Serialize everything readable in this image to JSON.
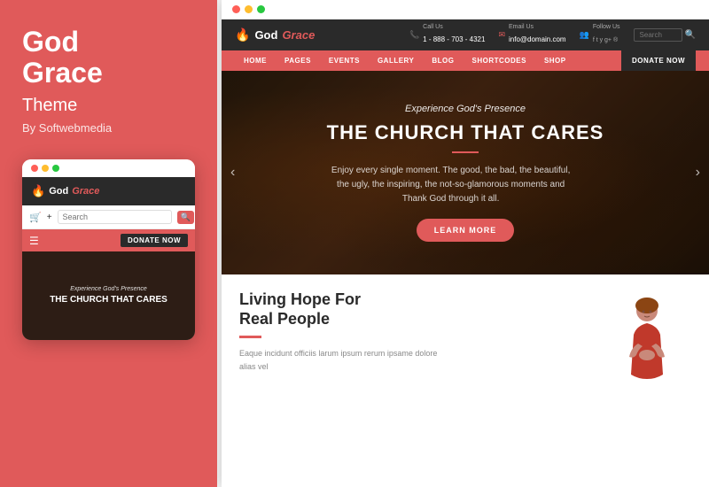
{
  "left": {
    "title_line1": "God",
    "title_line2": "Grace",
    "subtitle": "Theme",
    "by_text": "By Softwebmedia"
  },
  "mobile": {
    "dots": [
      "red",
      "yellow",
      "green"
    ],
    "logo_god": "God",
    "logo_grace": "Grace",
    "search_placeholder": "Search",
    "donate_btn": "DONATE NOW",
    "hero_sub": "Experience God's Presence",
    "hero_title": "THE CHURCH THAT CARES"
  },
  "desktop": {
    "dots": [
      "red",
      "yellow",
      "green"
    ],
    "logo_god": "God",
    "logo_grace": "Grace",
    "header": {
      "call_label": "Call Us",
      "call_value": "1 - 888 - 703 - 4321",
      "email_label": "Email Us",
      "email_value": "info@domain.com",
      "follow_label": "Follow Us",
      "search_placeholder": "Search"
    },
    "nav": {
      "items": [
        "HOME",
        "PAGES",
        "EVENTS",
        "GALLERY",
        "BLOG",
        "SHORTCODES",
        "SHOP"
      ],
      "donate_btn": "DONATE NOW"
    },
    "hero": {
      "sub": "Experience God's Presence",
      "title": "THE CHURCH THAT CARES",
      "desc": "Enjoy every single moment. The good, the bad, the beautiful, the ugly, the inspiring, the not-so-glamorous moments and Thank God through it all.",
      "btn": "LEARN MORE"
    },
    "bottom": {
      "title_line1": "Living Hope For",
      "title_line2": "Real People",
      "desc": "Eaque incidunt officiis larum ipsum rerum ipsame dolore alias vel"
    }
  }
}
